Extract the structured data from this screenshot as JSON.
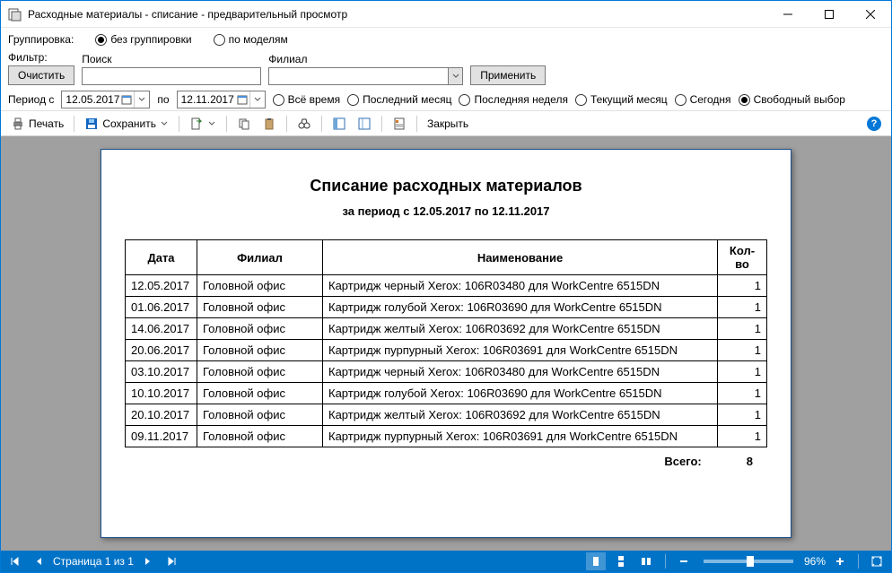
{
  "window": {
    "title": "Расходные материалы - списание - предварительный просмотр"
  },
  "grouping": {
    "label": "Группировка:",
    "none": "без группировки",
    "by_models": "по моделям"
  },
  "filter": {
    "label": "Фильтр:",
    "search_label": "Поиск",
    "branch_label": "Филиал",
    "clear": "Очистить",
    "apply": "Применить",
    "search_value": "",
    "branch_value": ""
  },
  "period": {
    "label_from": "Период с",
    "label_to": "по",
    "from": "12.05.2017",
    "to": "12.11.2017",
    "all_time": "Всё время",
    "last_month": "Последний месяц",
    "last_week": "Последняя неделя",
    "current_month": "Текущий месяц",
    "today": "Сегодня",
    "free": "Свободный выбор"
  },
  "toolbar": {
    "print": "Печать",
    "save": "Сохранить",
    "close": "Закрыть"
  },
  "report": {
    "title": "Списание расходных материалов",
    "subtitle": "за период с 12.05.2017 по 12.11.2017",
    "columns": {
      "date": "Дата",
      "branch": "Филиал",
      "name": "Наименование",
      "qty": "Кол-во"
    },
    "rows": [
      {
        "date": "12.05.2017",
        "branch": "Головной офис",
        "name": "Картридж черный Xerox: 106R03480 для WorkCentre 6515DN",
        "qty": "1"
      },
      {
        "date": "01.06.2017",
        "branch": "Головной офис",
        "name": "Картридж голубой Xerox: 106R03690 для WorkCentre 6515DN",
        "qty": "1"
      },
      {
        "date": "14.06.2017",
        "branch": "Головной офис",
        "name": "Картридж желтый Xerox: 106R03692 для WorkCentre 6515DN",
        "qty": "1"
      },
      {
        "date": "20.06.2017",
        "branch": "Головной офис",
        "name": "Картридж пурпурный Xerox: 106R03691 для WorkCentre 6515DN",
        "qty": "1"
      },
      {
        "date": "03.10.2017",
        "branch": "Головной офис",
        "name": "Картридж черный Xerox: 106R03480 для WorkCentre 6515DN",
        "qty": "1"
      },
      {
        "date": "10.10.2017",
        "branch": "Головной офис",
        "name": "Картридж голубой Xerox: 106R03690 для WorkCentre 6515DN",
        "qty": "1"
      },
      {
        "date": "20.10.2017",
        "branch": "Головной офис",
        "name": "Картридж желтый Xerox: 106R03692 для WorkCentre 6515DN",
        "qty": "1"
      },
      {
        "date": "09.11.2017",
        "branch": "Головной офис",
        "name": "Картридж пурпурный Xerox: 106R03691 для WorkCentre 6515DN",
        "qty": "1"
      }
    ],
    "total_label": "Всего:",
    "total_value": "8"
  },
  "statusbar": {
    "page": "Страница 1 из 1",
    "zoom": "96%"
  }
}
